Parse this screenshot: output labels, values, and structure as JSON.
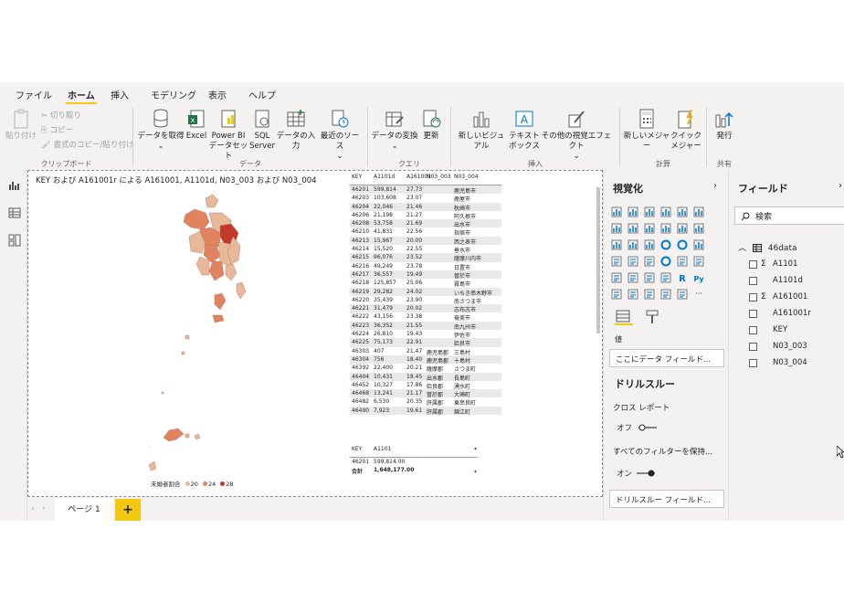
{
  "menu": {
    "tabs": [
      "ファイル",
      "ホーム",
      "挿入",
      "モデリング",
      "表示",
      "ヘルプ"
    ],
    "active": "ホーム"
  },
  "ribbon": {
    "clipboard": {
      "paste": "貼り付け",
      "cut": "切り取り",
      "copy": "コピー",
      "format_painter": "書式のコピー/貼り付け",
      "group": "クリップボード"
    },
    "data": {
      "get_data": "データを取得",
      "excel": "Excel",
      "pbi_dataset_1": "Power BI",
      "pbi_dataset_2": "データセット",
      "sql_1": "SQL",
      "sql_2": "Server",
      "enter_data": "データの入力",
      "recent_sources": "最近のソース",
      "group": "データ"
    },
    "query": {
      "transform": "データの変換",
      "refresh": "更新",
      "group": "クエリ"
    },
    "insert": {
      "new_visual": "新しいビジュアル",
      "textbox_1": "テキスト",
      "textbox_2": "ボックス",
      "more_visuals": "その他の視覚エフェクト",
      "group": "挿入"
    },
    "calculations": {
      "new_measure": "新しいメジャー",
      "quick_measure_1": "クイック",
      "quick_measure_2": "メジャー",
      "group": "計算"
    },
    "share": {
      "publish": "発行",
      "group": "共有"
    }
  },
  "report": {
    "title": "KEY および A161001r による A161001, A1101d, N03_003 および N03_004",
    "legend_label": "未婚者割合",
    "legend_items": [
      {
        "label": "20",
        "color": "#e8b89a"
      },
      {
        "label": "24",
        "color": "#e0835e"
      },
      {
        "label": "28",
        "color": "#c0392b"
      }
    ]
  },
  "table1": {
    "headers": [
      "KEY",
      "A1101d",
      "A161001",
      "N03_003",
      "N03_004"
    ],
    "rows": [
      [
        "46201",
        "599,814",
        "27.73",
        "",
        "鹿児島市"
      ],
      [
        "46203",
        "103,608",
        "23.07",
        "",
        "鹿屋市"
      ],
      [
        "46204",
        "22,046",
        "21.46",
        "",
        "枕崎市"
      ],
      [
        "46206",
        "21,198",
        "21.27",
        "",
        "阿久根市"
      ],
      [
        "46208",
        "53,758",
        "21.69",
        "",
        "出水市"
      ],
      [
        "46210",
        "41,831",
        "22.56",
        "",
        "指宿市"
      ],
      [
        "46213",
        "15,967",
        "20.00",
        "",
        "西之表市"
      ],
      [
        "46214",
        "15,520",
        "22.55",
        "",
        "垂水市"
      ],
      [
        "46215",
        "96,076",
        "23.52",
        "",
        "薩摩川内市"
      ],
      [
        "46216",
        "49,249",
        "23.78",
        "",
        "日置市"
      ],
      [
        "46217",
        "36,557",
        "19.49",
        "",
        "曽於市"
      ],
      [
        "46218",
        "125,857",
        "25.06",
        "",
        "霧島市"
      ],
      [
        "46219",
        "29,282",
        "24.02",
        "",
        "いちき串木野市"
      ],
      [
        "46220",
        "35,439",
        "23.90",
        "",
        "南さつま市"
      ],
      [
        "46221",
        "31,479",
        "20.02",
        "",
        "志布志市"
      ],
      [
        "46222",
        "43,156",
        "23.38",
        "",
        "奄美市"
      ],
      [
        "46223",
        "36,352",
        "21.55",
        "",
        "南九州市"
      ],
      [
        "46224",
        "26,810",
        "19.43",
        "",
        "伊佐市"
      ],
      [
        "46225",
        "75,173",
        "22.91",
        "",
        "姶良市"
      ],
      [
        "46303",
        "407",
        "21.47",
        "鹿児島郡",
        "三島村"
      ],
      [
        "46304",
        "756",
        "18.40",
        "鹿児島郡",
        "十島村"
      ],
      [
        "46392",
        "22,400",
        "20.21",
        "薩摩郡",
        "さつま町"
      ],
      [
        "46404",
        "10,431",
        "18.45",
        "出水郡",
        "長島町"
      ],
      [
        "46452",
        "10,327",
        "17.86",
        "姶良郡",
        "湧水町"
      ],
      [
        "46468",
        "13,241",
        "21.17",
        "曽於郡",
        "大崎町"
      ],
      [
        "46482",
        "6,530",
        "20.35",
        "肝属郡",
        "東串良町"
      ],
      [
        "46490",
        "7,923",
        "19.61",
        "肝属郡",
        "錦江町"
      ]
    ]
  },
  "table2": {
    "headers": [
      "KEY",
      "A1101"
    ],
    "rows": [
      [
        "46201",
        "599,814.00"
      ]
    ],
    "total_label": "合計",
    "total_value": "1,648,177.00"
  },
  "pages": {
    "tab": "ページ 1",
    "add": "+"
  },
  "visualizations": {
    "title": "視覚化",
    "values_label": "値",
    "values_placeholder": "ここにデータ フィールド...",
    "drillthrough_title": "ドリルスルー",
    "cross_report_label": "クロス レポート",
    "cross_report_state": "オフ",
    "keep_filters_label": "すべてのフィルターを保持...",
    "keep_filters_state": "オン",
    "drillthrough_placeholder": "ドリルスルー フィールド..."
  },
  "fields": {
    "title": "フィールド",
    "search_placeholder": "検索",
    "table_name": "46data",
    "items": [
      {
        "name": "A1101",
        "sigma": "Σ"
      },
      {
        "name": "A1101d",
        "sigma": ""
      },
      {
        "name": "A161001",
        "sigma": "Σ"
      },
      {
        "name": "A161001r",
        "sigma": ""
      },
      {
        "name": "KEY",
        "sigma": ""
      },
      {
        "name": "N03_003",
        "sigma": ""
      },
      {
        "name": "N03_004",
        "sigma": ""
      }
    ]
  },
  "colors": {
    "accent": "#f2c811",
    "map_light": "#e8b89a",
    "map_mid": "#e0835e",
    "map_dark": "#c0392b"
  }
}
